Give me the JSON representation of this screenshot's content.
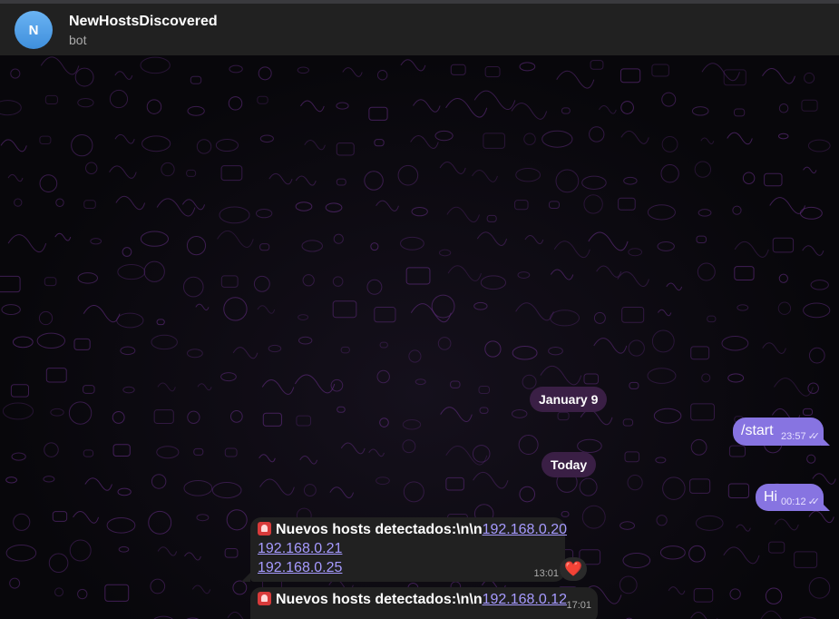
{
  "header": {
    "avatar_letter": "N",
    "title": "NewHostsDiscovered",
    "status": "bot"
  },
  "dates": {
    "first": "January 9",
    "second": "Today"
  },
  "messages": {
    "start": {
      "text": "/start",
      "time": "23:57",
      "status_icon": "double-check-icon"
    },
    "hi": {
      "text": "Hi",
      "time": "00:12",
      "status_icon": "double-check-icon"
    },
    "alert1": {
      "prefix": "Nuevos hosts detectados:\\n\\n",
      "hosts": [
        "192.168.0.20",
        "192.168.0.21",
        "192.168.0.25"
      ],
      "time": "13:01",
      "reaction": "❤️",
      "icon": "siren-emoji-icon"
    },
    "alert2": {
      "prefix": "Nuevos hosts detectados:\\n\\n",
      "hosts": [
        "192.168.0.12"
      ],
      "time": "17:01",
      "icon": "siren-emoji-icon"
    }
  },
  "colors": {
    "header_bg": "#212121",
    "outgoing_bubble": "#8774e1",
    "incoming_bubble": "#212121",
    "date_pill": "#3a1f45",
    "link": "#a69aff",
    "pattern": "#5b2a78"
  }
}
